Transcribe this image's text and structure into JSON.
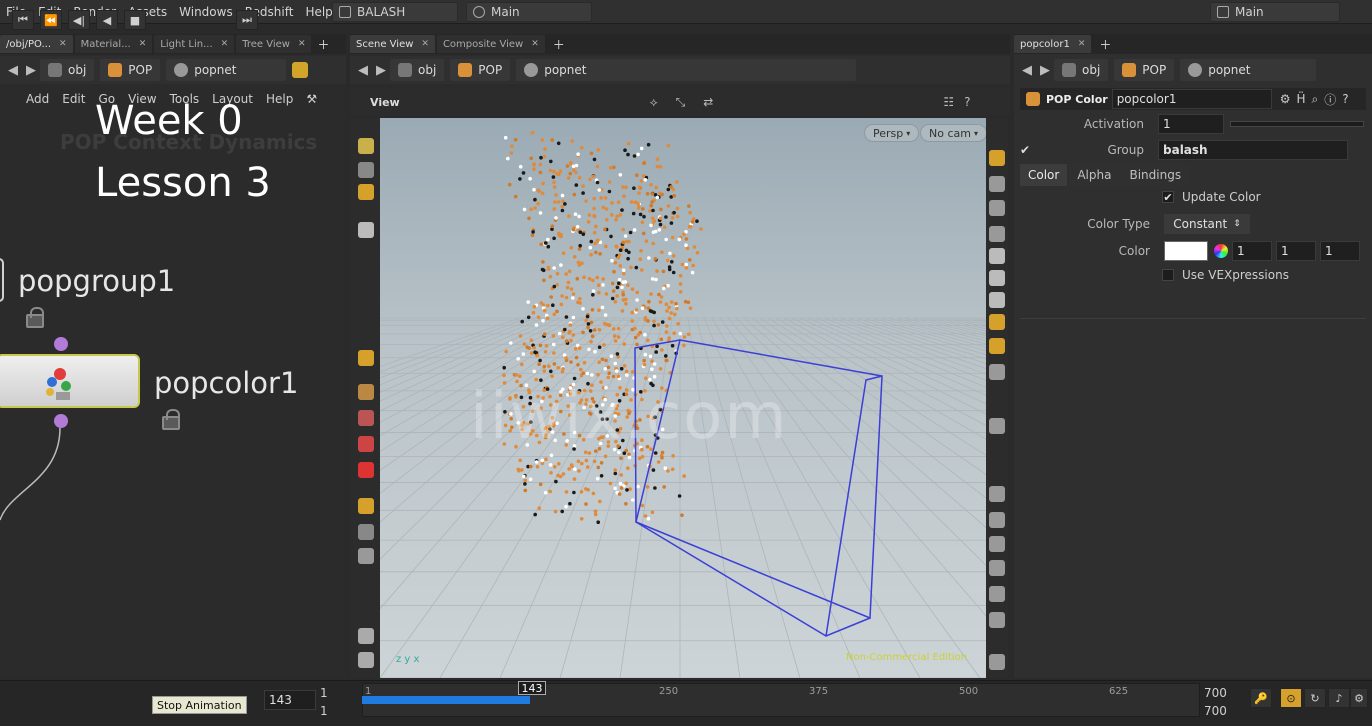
{
  "menu": [
    "File",
    "Edit",
    "Render",
    "Assets",
    "Windows",
    "Redshift",
    "Help"
  ],
  "desktop": "BALASH",
  "scene": "Main",
  "right_desk": "Main",
  "left_pane": {
    "tabs": [
      "/obj/PO...",
      "Material...",
      "Light Lin...",
      "Tree View"
    ],
    "path": [
      "obj",
      "POP",
      "popnet"
    ],
    "menu": [
      "Add",
      "Edit",
      "Go",
      "View",
      "Tools",
      "Layout",
      "Help"
    ],
    "overlay_line1": "Week 0",
    "overlay_line2": "Lesson 3",
    "faded_label": "POP Context   Dynamics",
    "nodes": [
      {
        "label": "popgroup1"
      },
      {
        "label": "popcolor1"
      }
    ]
  },
  "center_pane": {
    "tabs": [
      "Scene View",
      "Composite View"
    ],
    "path": [
      "obj",
      "POP",
      "popnet"
    ],
    "view_label": "View",
    "persp": "Persp",
    "cam": "No cam",
    "watermark": "iiwix.com",
    "status": "Non-Commercial Edition"
  },
  "right_pane": {
    "tab": "popcolor1",
    "path": [
      "obj",
      "POP",
      "popnet"
    ],
    "node_type": "POP Color",
    "node_name": "popcolor1",
    "activation_label": "Activation",
    "activation_value": "1",
    "group_label": "Group",
    "group_value": "balash",
    "subtabs": [
      "Color",
      "Alpha",
      "Bindings"
    ],
    "update_color_label": "Update Color",
    "color_type_label": "Color Type",
    "color_type_value": "Constant",
    "color_label": "Color",
    "color_values": [
      "1",
      "1",
      "1"
    ],
    "use_vex_label": "Use VEXpressions"
  },
  "timeline": {
    "current_frame": "143",
    "start_top": "1",
    "start_bottom": "1",
    "ruler_ticks": [
      "1",
      "143",
      "250",
      "375",
      "500",
      "625"
    ],
    "end_top": "700",
    "end_bottom": "700",
    "tooltip": "Stop Animation",
    "progress": 0.2
  },
  "colors": {
    "accent_blue": "#1f7be0",
    "node_highlight": "#c7c94a",
    "port_purple": "#b27bd8",
    "particle_orange": "#e08a3a"
  }
}
